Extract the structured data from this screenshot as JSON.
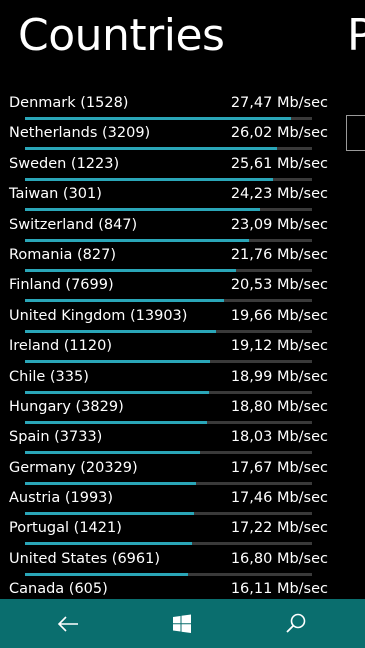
{
  "page": {
    "title": "Countries",
    "next_title_peek": "P"
  },
  "rows": [
    {
      "name": "Denmark (1528)",
      "speed": "27,47 Mb/sec",
      "value": 27.47
    },
    {
      "name": "Netherlands (3209)",
      "speed": "26,02 Mb/sec",
      "value": 26.02
    },
    {
      "name": "Sweden (1223)",
      "speed": "25,61 Mb/sec",
      "value": 25.61
    },
    {
      "name": "Taiwan (301)",
      "speed": "24,23 Mb/sec",
      "value": 24.23
    },
    {
      "name": "Switzerland (847)",
      "speed": "23,09 Mb/sec",
      "value": 23.09
    },
    {
      "name": "Romania (827)",
      "speed": "21,76 Mb/sec",
      "value": 21.76
    },
    {
      "name": "Finland (7699)",
      "speed": "20,53 Mb/sec",
      "value": 20.53
    },
    {
      "name": "United Kingdom (13903)",
      "speed": "19,66 Mb/sec",
      "value": 19.66
    },
    {
      "name": "Ireland (1120)",
      "speed": "19,12 Mb/sec",
      "value": 19.12
    },
    {
      "name": "Chile (335)",
      "speed": "18,99 Mb/sec",
      "value": 18.99
    },
    {
      "name": "Hungary (3829)",
      "speed": "18,80 Mb/sec",
      "value": 18.8
    },
    {
      "name": "Spain (3733)",
      "speed": "18,03 Mb/sec",
      "value": 18.03
    },
    {
      "name": "Germany (20329)",
      "speed": "17,67 Mb/sec",
      "value": 17.67
    },
    {
      "name": "Austria (1993)",
      "speed": "17,46 Mb/sec",
      "value": 17.46
    },
    {
      "name": "Portugal (1421)",
      "speed": "17,22 Mb/sec",
      "value": 17.22
    },
    {
      "name": "United States (6961)",
      "speed": "16,80 Mb/sec",
      "value": 16.8
    },
    {
      "name": "Canada (605)",
      "speed": "16,11 Mb/sec",
      "value": 16.11
    }
  ],
  "navbar": {
    "back_icon": "back-arrow-icon",
    "start_icon": "windows-logo-icon",
    "search_icon": "search-icon",
    "background_color": "#0a6e6e"
  },
  "colors": {
    "bar_fill": "#2aa6b8",
    "bar_track": "#3a3a3a"
  }
}
